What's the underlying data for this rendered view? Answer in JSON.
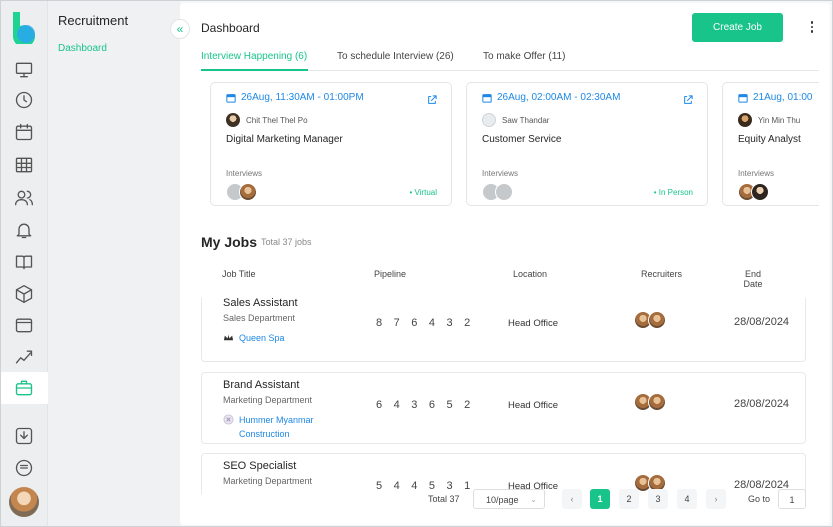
{
  "app": {
    "section_title": "Recruitment",
    "nav_item": "Dashboard",
    "brand_color": "#19c48a",
    "link_color": "#1e88e5"
  },
  "rail_icons": [
    "monitor-icon",
    "clock-icon",
    "calendar-icon",
    "table-icon",
    "users-icon",
    "bell-icon",
    "book-icon",
    "cube-icon",
    "wallet-icon",
    "analytics-icon",
    "briefcase-icon",
    "download-icon",
    "chat-icon"
  ],
  "header": {
    "title": "Dashboard",
    "create_label": "Create Job"
  },
  "tabs": [
    {
      "label": "Interview Happening (6)",
      "active": true
    },
    {
      "label": "To schedule Interview (26)",
      "active": false
    },
    {
      "label": "To make Offer (11)",
      "active": false
    }
  ],
  "interviews": [
    {
      "time": "26Aug, 11:30AM - 01:00PM",
      "person": "Chit Thel Thel Po",
      "role": "Digital Marketing Manager",
      "label": "Interviews",
      "mode": "• Virtual"
    },
    {
      "time": "26Aug, 02:00AM - 02:30AM",
      "person": "Saw Thandar",
      "role": "Customer Service",
      "label": "Interviews",
      "mode": "• In Person"
    },
    {
      "time": "21Aug, 01:00",
      "person": "Yin Min Thu",
      "role": "Equity Analyst",
      "label": "Interviews",
      "mode": ""
    }
  ],
  "jobs": {
    "title": "My Jobs",
    "total": "Total 37 jobs",
    "columns": {
      "title": "Job Title",
      "pipeline": "Pipeline",
      "location": "Location",
      "recruiters": "Recruiters",
      "end_date": "End Date"
    },
    "rows": [
      {
        "title": "Sales Assistant",
        "dept": "Sales Department",
        "client": "Queen Spa",
        "pipeline": [
          "8",
          "7",
          "6",
          "4",
          "3",
          "2"
        ],
        "location": "Head Office",
        "end": "28/08/2024"
      },
      {
        "title": "Brand Assistant",
        "dept": "Marketing Department",
        "client": "Hummer Myanmar Construction",
        "pipeline": [
          "6",
          "4",
          "3",
          "6",
          "5",
          "2"
        ],
        "location": "Head Office",
        "end": "28/08/2024"
      },
      {
        "title": "SEO Specialist",
        "dept": "Marketing Department",
        "client": "",
        "pipeline": [
          "5",
          "4",
          "4",
          "5",
          "3",
          "1"
        ],
        "location": "Head Office",
        "end": "28/08/2024"
      }
    ]
  },
  "pagination": {
    "total": "Total 37",
    "page_size": "10/page",
    "prev": "‹",
    "next": "›",
    "pages": [
      "1",
      "2",
      "3",
      "4"
    ],
    "current": "1",
    "goto_label": "Go to",
    "goto_value": "1"
  }
}
